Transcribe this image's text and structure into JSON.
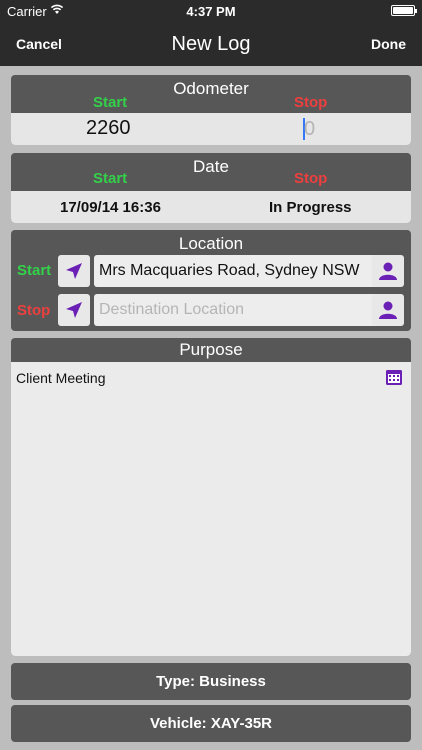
{
  "status": {
    "carrier": "Carrier",
    "time": "4:37 PM"
  },
  "nav": {
    "cancel": "Cancel",
    "title": "New Log",
    "done": "Done"
  },
  "odometer": {
    "title": "Odometer",
    "start_label": "Start",
    "stop_label": "Stop",
    "start_value": "2260",
    "stop_placeholder": "0"
  },
  "date": {
    "title": "Date",
    "start_label": "Start",
    "stop_label": "Stop",
    "start_value": "17/09/14 16:36",
    "stop_value": "In Progress"
  },
  "location": {
    "title": "Location",
    "start_label": "Start",
    "stop_label": "Stop",
    "start_value": "Mrs Macquaries Road, Sydney NSW",
    "stop_placeholder": "Destination Location"
  },
  "purpose": {
    "title": "Purpose",
    "value": "Client Meeting"
  },
  "type_button": "Type: Business",
  "vehicle_button": "Vehicle: XAY-35R",
  "colors": {
    "accent_purple": "#6a1fb5",
    "start_green": "#33d14a",
    "stop_red": "#ee3f3f"
  },
  "icons": [
    "wifi-icon",
    "battery-icon",
    "location-arrow-icon",
    "contact-person-icon",
    "calendar-icon"
  ]
}
